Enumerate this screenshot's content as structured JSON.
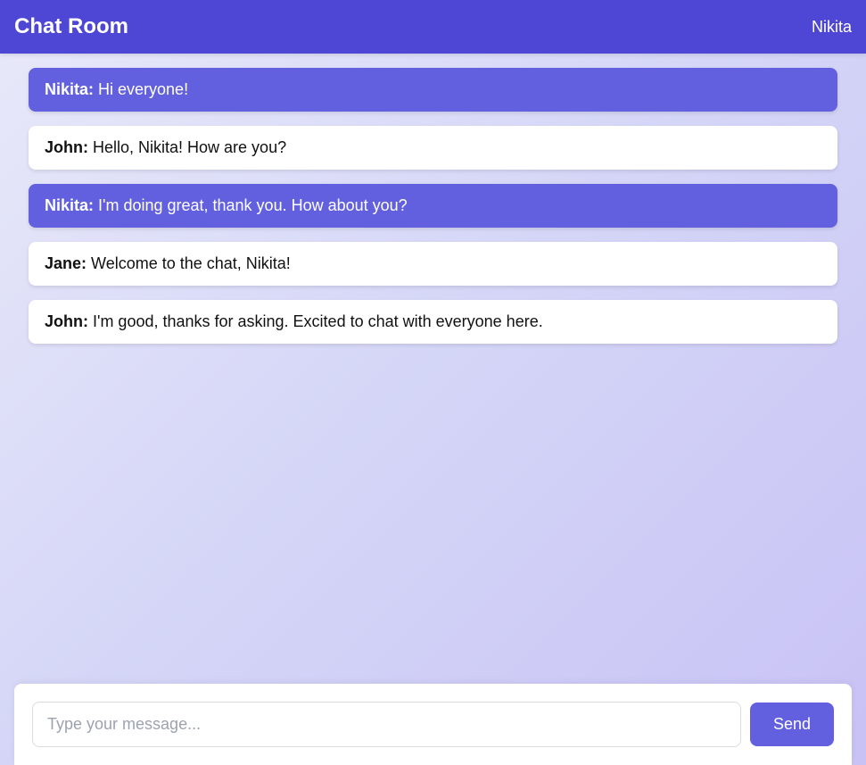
{
  "header": {
    "title": "Chat Room",
    "current_user": "Nikita"
  },
  "messages": [
    {
      "sender": "Nikita",
      "text": "Hi everyone!",
      "is_own": true
    },
    {
      "sender": "John",
      "text": "Hello, Nikita! How are you?",
      "is_own": false
    },
    {
      "sender": "Nikita",
      "text": "I'm doing great, thank you. How about you?",
      "is_own": true
    },
    {
      "sender": "Jane",
      "text": "Welcome to the chat, Nikita!",
      "is_own": false
    },
    {
      "sender": "John",
      "text": "I'm good, thanks for asking. Excited to chat with everyone here.",
      "is_own": false
    }
  ],
  "input": {
    "placeholder": "Type your message...",
    "value": "",
    "send_label": "Send"
  }
}
